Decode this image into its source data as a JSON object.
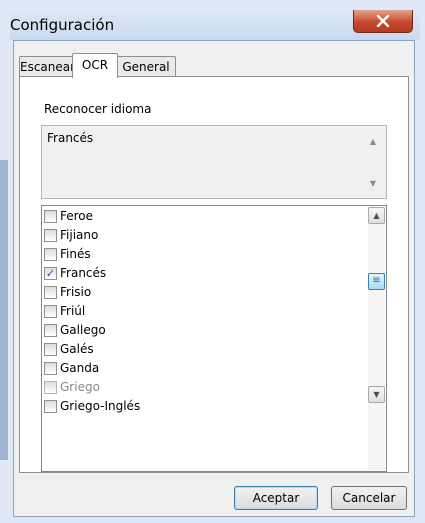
{
  "window": {
    "title": "Configuración"
  },
  "tabs": [
    {
      "label": "Escanear"
    },
    {
      "label": "OCR",
      "active": true
    },
    {
      "label": "General"
    }
  ],
  "ocr": {
    "section_label": "Reconocer idioma",
    "selected_languages": [
      "Francés"
    ],
    "languages": [
      {
        "label": "Feroe",
        "checked": false
      },
      {
        "label": "Fijiano",
        "checked": false
      },
      {
        "label": "Finés",
        "checked": false
      },
      {
        "label": "Francés",
        "checked": true
      },
      {
        "label": "Frisio",
        "checked": false
      },
      {
        "label": "Friúl",
        "checked": false
      },
      {
        "label": "Gallego",
        "checked": false
      },
      {
        "label": "Galés",
        "checked": false
      },
      {
        "label": "Ganda",
        "checked": false
      },
      {
        "label": "Griego",
        "checked": false,
        "disabled": true
      },
      {
        "label": "Griego-Inglés",
        "checked": false
      }
    ]
  },
  "buttons": {
    "ok": "Aceptar",
    "cancel": "Cancelar"
  },
  "icons": {
    "close": "close-icon",
    "scroll_up": "chevron-up-icon",
    "scroll_down": "chevron-down-icon",
    "scroll_thumb": "grip-icon",
    "check": "check-icon"
  },
  "colors": {
    "close_button": "#c44a2d",
    "window_frame": "#dfe9f5",
    "accent": "#3c7fb1"
  }
}
